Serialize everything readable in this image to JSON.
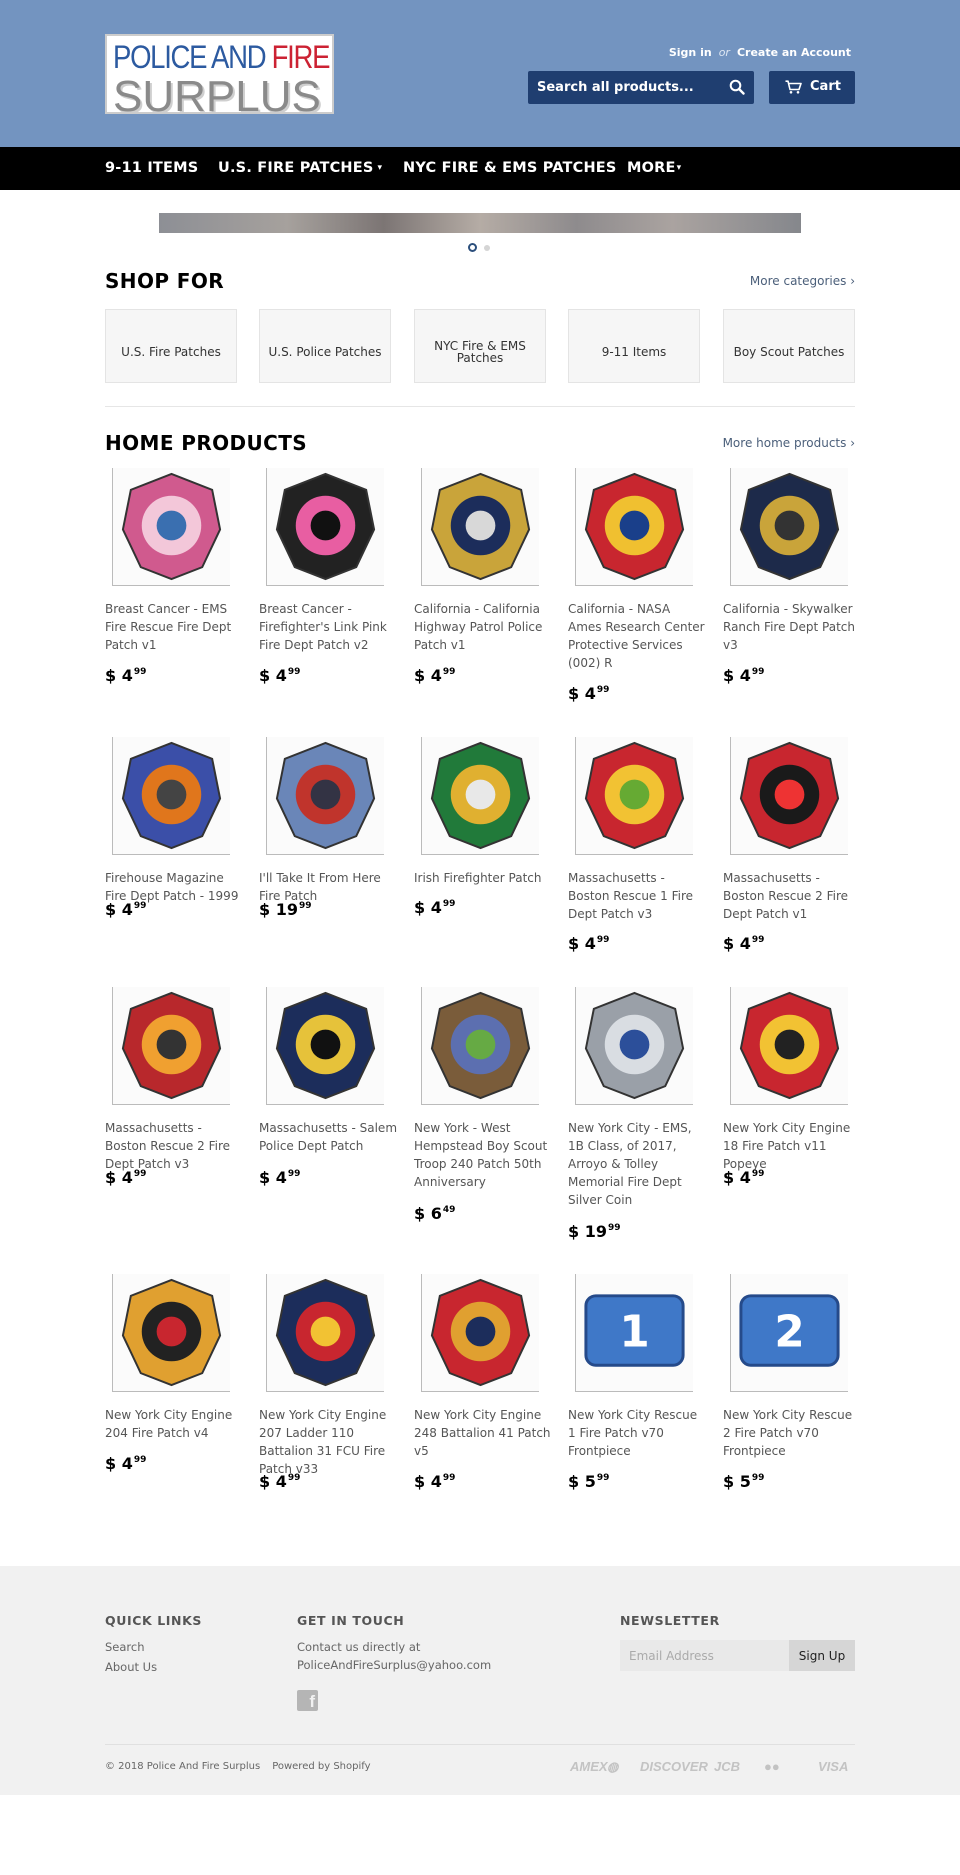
{
  "header": {
    "sign_in": "Sign in",
    "or": "or",
    "create_account": "Create an Account",
    "search_placeholder": "Search all products...",
    "cart_label": "Cart"
  },
  "logo": {
    "line1_a": "POLICE AND ",
    "line1_b": "FIRE",
    "line2": "SURPLUS"
  },
  "nav": [
    {
      "label": "9-11 ITEMS"
    },
    {
      "label": "U.S. FIRE PATCHES",
      "caret": "▾"
    },
    {
      "label": "NYC FIRE & EMS PATCHES"
    },
    {
      "label": "MORE",
      "caret": "▾"
    }
  ],
  "shop_for": {
    "title": "SHOP FOR",
    "more_link": "More categories ›",
    "categories": [
      "U.S. Fire Patches",
      "U.S. Police Patches",
      "NYC Fire & EMS Patches",
      "9-11 Items",
      "Boy Scout Patches"
    ]
  },
  "home_products": {
    "title": "HOME PRODUCTS",
    "more_link": "More home products ›",
    "products": [
      {
        "name": "Breast Cancer - EMS Fire Rescue Fire Dept Patch v1",
        "dollars": "$ 4",
        "cents": "99"
      },
      {
        "name": "Breast Cancer - Firefighter's Link Pink Fire Dept Patch v2",
        "dollars": "$ 4",
        "cents": "99"
      },
      {
        "name": "California - California Highway Patrol Police Patch v1",
        "dollars": "$ 4",
        "cents": "99"
      },
      {
        "name": "California - NASA Ames Research Center Protective Services (002) R",
        "dollars": "$ 4",
        "cents": "99"
      },
      {
        "name": "California - Skywalker Ranch Fire Dept Patch v3",
        "dollars": "$ 4",
        "cents": "99"
      },
      {
        "name": "Firehouse Magazine Fire Dept Patch - 1999",
        "dollars": "$ 4",
        "cents": "99"
      },
      {
        "name": "I'll Take It From Here Fire Patch",
        "dollars": "$ 19",
        "cents": "99"
      },
      {
        "name": "Irish Firefighter Patch",
        "dollars": "$ 4",
        "cents": "99"
      },
      {
        "name": "Massachusetts - Boston Rescue 1 Fire Dept Patch v3",
        "dollars": "$ 4",
        "cents": "99"
      },
      {
        "name": "Massachusetts - Boston Rescue 2 Fire Dept Patch v1",
        "dollars": "$ 4",
        "cents": "99"
      },
      {
        "name": "Massachusetts - Boston Rescue 2 Fire Dept Patch v3",
        "dollars": "$ 4",
        "cents": "99"
      },
      {
        "name": "Massachusetts - Salem Police Dept Patch",
        "dollars": "$ 4",
        "cents": "99"
      },
      {
        "name": "New York - West Hempstead Boy Scout Troop 240 Patch 50th Anniversary",
        "dollars": "$ 6",
        "cents": "49"
      },
      {
        "name": "New York City - EMS, 1B Class, of 2017, Arroyo & Tolley Memorial Fire Dept Silver Coin",
        "dollars": "$ 19",
        "cents": "99"
      },
      {
        "name": "New York City Engine 18 Fire Patch v11 Popeye",
        "dollars": "$ 4",
        "cents": "99"
      },
      {
        "name": "New York City Engine 204 Fire Patch v4",
        "dollars": "$ 4",
        "cents": "99"
      },
      {
        "name": "New York City Engine 207 Ladder 110 Battalion 31 FCU Fire Patch v33",
        "dollars": "$ 4",
        "cents": "99"
      },
      {
        "name": "New York City Engine 248 Battalion 41 Patch v5",
        "dollars": "$ 4",
        "cents": "99"
      },
      {
        "name": "New York City Rescue 1 Fire Patch v70 Frontpiece",
        "dollars": "$ 5",
        "cents": "99"
      },
      {
        "name": "New York City Rescue 2 Fire Patch v70 Frontpiece",
        "dollars": "$ 5",
        "cents": "99"
      }
    ]
  },
  "footer": {
    "quick_links_title": "QUICK LINKS",
    "quick_links": [
      "Search",
      "About Us"
    ],
    "contact_title": "GET IN TOUCH",
    "contact_text": "Contact us directly at",
    "contact_email": "PoliceAndFireSurplus@yahoo.com",
    "facebook_glyph": "f",
    "newsletter_title": "NEWSLETTER",
    "email_placeholder": "Email Address",
    "signup_label": "Sign Up",
    "copyright": "© 2018 Police And Fire Surplus",
    "powered_by": "Powered by Shopify",
    "payment_icons": [
      "american-express-icon",
      "diners-club-icon",
      "discover-icon",
      "jcb-icon",
      "master-icon",
      "visa-icon"
    ],
    "payment_labels": [
      "AMEX",
      "◍",
      "DISCOVER",
      "JCB",
      "●●",
      "VISA"
    ]
  },
  "colors": {
    "header_bg": "#7394c0",
    "header_button": "#1f3e70",
    "nav_bg": "#000000",
    "footer_bg": "#f1f1f1"
  }
}
